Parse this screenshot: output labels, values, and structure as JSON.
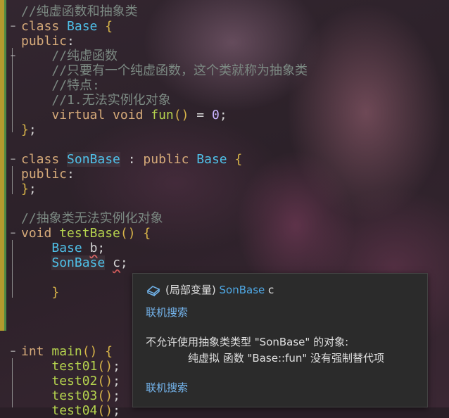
{
  "code": {
    "lines": [
      {
        "fold": false,
        "segments": [
          [
            "cm",
            "//纯虚函数和抽象类"
          ]
        ]
      },
      {
        "fold": true,
        "segments": [
          [
            "kw",
            "class "
          ],
          [
            "ty",
            "Base"
          ],
          [
            "",
            " "
          ],
          [
            "pn",
            "{"
          ]
        ]
      },
      {
        "fold": false,
        "segments": [
          [
            "kw",
            "public"
          ],
          [
            "",
            ":"
          ]
        ]
      },
      {
        "fold": true,
        "segments": [
          [
            "",
            "    "
          ],
          [
            "cm",
            "//纯虚函数"
          ]
        ]
      },
      {
        "fold": false,
        "segments": [
          [
            "",
            "    "
          ],
          [
            "cm",
            "//只要有一个纯虚函数，这个类就称为抽象类"
          ]
        ]
      },
      {
        "fold": false,
        "segments": [
          [
            "",
            "    "
          ],
          [
            "cm",
            "//特点:"
          ]
        ]
      },
      {
        "fold": false,
        "segments": [
          [
            "",
            "    "
          ],
          [
            "cm",
            "//1.无法实例化对象"
          ]
        ]
      },
      {
        "fold": false,
        "segments": [
          [
            "",
            "    "
          ],
          [
            "kw",
            "virtual void "
          ],
          [
            "fn",
            "fun"
          ],
          [
            "pn",
            "()"
          ],
          [
            "",
            " = "
          ],
          [
            "num",
            "0"
          ],
          [
            "",
            ";"
          ]
        ]
      },
      {
        "fold": false,
        "segments": [
          [
            "pn",
            "}"
          ],
          [
            "",
            ";"
          ]
        ]
      },
      {
        "fold": false,
        "segments": []
      },
      {
        "fold": true,
        "segments": [
          [
            "kw",
            "class "
          ],
          [
            "ty hl",
            "SonBase"
          ],
          [
            "",
            " : "
          ],
          [
            "kw",
            "public "
          ],
          [
            "ty",
            "Base"
          ],
          [
            "",
            " "
          ],
          [
            "pn",
            "{"
          ]
        ]
      },
      {
        "fold": false,
        "segments": [
          [
            "kw",
            "public"
          ],
          [
            "",
            ":"
          ]
        ]
      },
      {
        "fold": false,
        "segments": [
          [
            "pn",
            "}"
          ],
          [
            "",
            ";"
          ]
        ]
      },
      {
        "fold": false,
        "segments": []
      },
      {
        "fold": false,
        "segments": [
          [
            "cm",
            "//抽象类无法实例化对象"
          ]
        ]
      },
      {
        "fold": true,
        "segments": [
          [
            "kw",
            "void "
          ],
          [
            "fn",
            "testBase"
          ],
          [
            "pn",
            "()"
          ],
          [
            "",
            " "
          ],
          [
            "pn",
            "{"
          ]
        ]
      },
      {
        "fold": false,
        "segments": [
          [
            "",
            "    "
          ],
          [
            "ty",
            "Base"
          ],
          [
            "",
            " "
          ],
          [
            "sq",
            "b"
          ],
          [
            "",
            ";"
          ]
        ]
      },
      {
        "fold": false,
        "segments": [
          [
            "",
            "    "
          ],
          [
            "ty hl",
            "SonBase"
          ],
          [
            "",
            " "
          ],
          [
            "sq",
            "c"
          ],
          [
            "",
            ";"
          ]
        ]
      },
      {
        "fold": false,
        "segments": []
      },
      {
        "fold": false,
        "segments": [
          [
            "",
            "    "
          ],
          [
            "pn",
            "}"
          ]
        ]
      },
      {
        "fold": false,
        "segments": []
      },
      {
        "fold": false,
        "segments": []
      },
      {
        "fold": false,
        "segments": []
      },
      {
        "fold": true,
        "segments": [
          [
            "kw",
            "int "
          ],
          [
            "fn",
            "main"
          ],
          [
            "pn",
            "()"
          ],
          [
            "",
            " "
          ],
          [
            "pn",
            "{"
          ]
        ]
      },
      {
        "fold": false,
        "segments": [
          [
            "",
            "    "
          ],
          [
            "fn",
            "test01"
          ],
          [
            "pn",
            "()"
          ],
          [
            "",
            ";"
          ]
        ]
      },
      {
        "fold": false,
        "segments": [
          [
            "",
            "    "
          ],
          [
            "fn",
            "test02"
          ],
          [
            "pn",
            "()"
          ],
          [
            "",
            ";"
          ]
        ]
      },
      {
        "fold": false,
        "segments": [
          [
            "",
            "    "
          ],
          [
            "fn",
            "test03"
          ],
          [
            "pn",
            "()"
          ],
          [
            "",
            ";"
          ]
        ]
      },
      {
        "fold": false,
        "segments": [
          [
            "",
            "    "
          ],
          [
            "fn",
            "test04"
          ],
          [
            "pn",
            "()"
          ],
          [
            "",
            ";"
          ]
        ]
      }
    ]
  },
  "tooltip": {
    "icon": "local-variable-cube-icon",
    "scope": "(局部变量)",
    "type": "SonBase",
    "var": "c",
    "search_label": "联机搜索",
    "error_line1": "不允许使用抽象类类型 \"SonBase\" 的对象:",
    "error_line2": "纯虚拟 函数 \"Base::fun\" 没有强制替代项",
    "search_label2": "联机搜索"
  }
}
